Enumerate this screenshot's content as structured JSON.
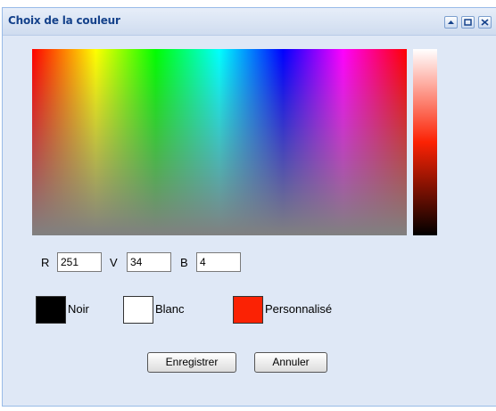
{
  "window": {
    "title": "Choix de la couleur"
  },
  "tools": [
    {
      "icon": "collapse-icon"
    },
    {
      "icon": "maximize-icon"
    },
    {
      "icon": "close-icon"
    }
  ],
  "rgb": {
    "r_label": "R",
    "r_value": "251",
    "v_label": "V",
    "v_value": "34",
    "b_label": "B",
    "b_value": "4"
  },
  "swatches": [
    {
      "label": "Noir",
      "color": "#000000"
    },
    {
      "label": "Blanc",
      "color": "#ffffff"
    },
    {
      "label": "Personnalisé",
      "color": "#fb2204"
    }
  ],
  "buttons": {
    "save": "Enregistrer",
    "cancel": "Annuler"
  },
  "colors": {
    "title_text": "#15428b",
    "panel_bg": "#dfe8f6",
    "border": "#99bbe8"
  }
}
